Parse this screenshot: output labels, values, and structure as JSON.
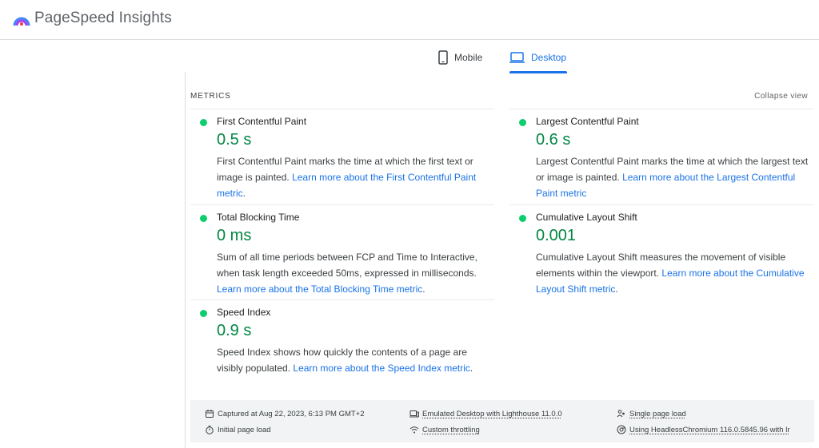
{
  "header": {
    "brand": "PageSpeed Insights"
  },
  "tabs": [
    {
      "label": "Mobile",
      "active": false
    },
    {
      "label": "Desktop",
      "active": true
    }
  ],
  "metrics": {
    "title": "METRICS",
    "collapse_label": "Collapse view",
    "status_color": "#0cce6b",
    "value_color": "#018642",
    "items": {
      "fcp": {
        "name": "First Contentful Paint",
        "value": "0.5 s",
        "desc": "First Contentful Paint marks the time at which the first text or image is painted.",
        "link": "Learn more about the First Contentful Paint metric"
      },
      "lcp": {
        "name": "Largest Contentful Paint",
        "value": "0.6 s",
        "desc": "Largest Contentful Paint marks the time at which the largest text or image is painted.",
        "link": "Learn more about the Largest Contentful Paint metric"
      },
      "tbt": {
        "name": "Total Blocking Time",
        "value": "0 ms",
        "desc": "Sum of all time periods between FCP and Time to Interactive, when task length exceeded 50ms, expressed in milliseconds.",
        "link": "Learn more about the Total Blocking Time metric"
      },
      "cls": {
        "name": "Cumulative Layout Shift",
        "value": "0.001",
        "desc": "Cumulative Layout Shift measures the movement of visible elements within the viewport.",
        "link": "Learn more about the Cumulative Layout Shift metric"
      },
      "si": {
        "name": "Speed Index",
        "value": "0.9 s",
        "desc": "Speed Index shows how quickly the contents of a page are visibly populated.",
        "link": "Learn more about the Speed Index metric"
      }
    }
  },
  "info": {
    "captured": "Captured at Aug 22, 2023, 6:13 PM GMT+2",
    "initial_load": "Initial page load",
    "emulated": "Emulated Desktop with Lighthouse 11.0.0",
    "throttling": "Custom throttling",
    "single_load": "Single page load",
    "browser": "Using HeadlessChromium 116.0.5845.96 with lr"
  }
}
